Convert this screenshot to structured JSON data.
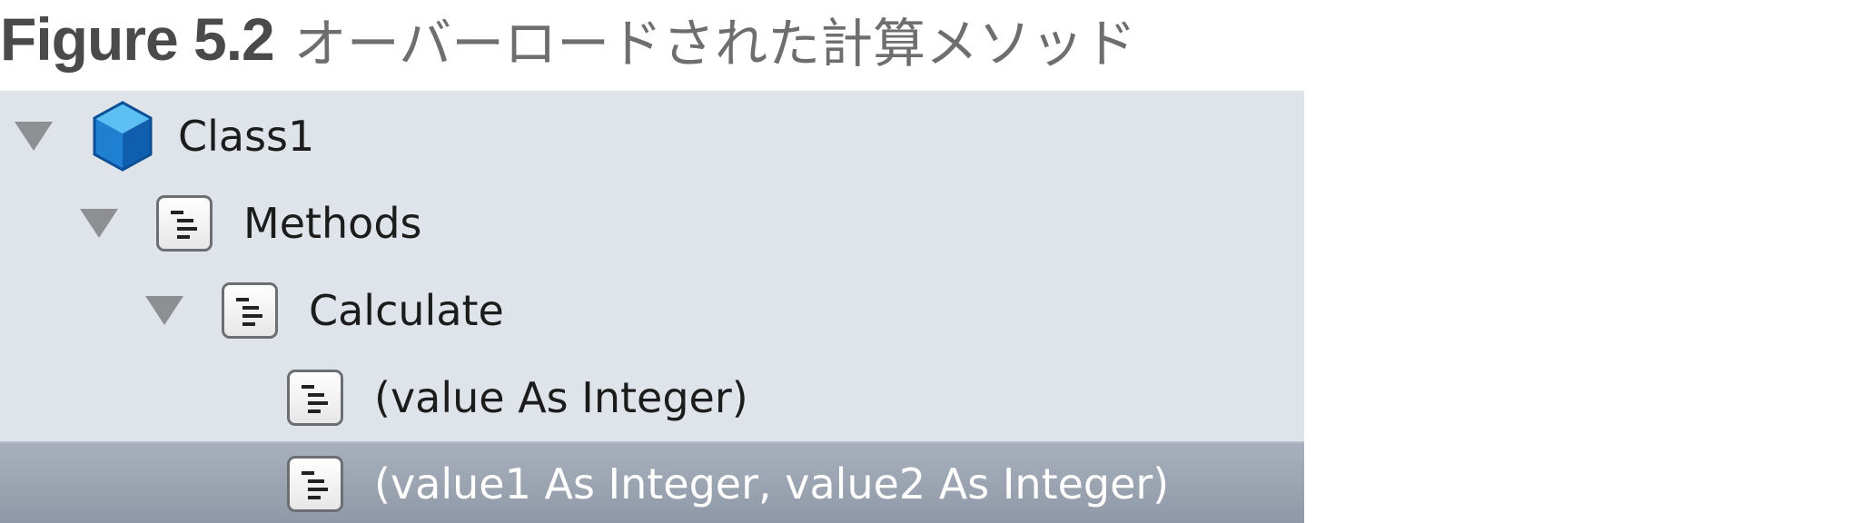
{
  "caption": {
    "label": "Figure 5.2",
    "text": "オーバーロードされた計算メソッド"
  },
  "tree": {
    "selected_color": "#9aa2af",
    "items": [
      {
        "label": "Class1",
        "icon": "cube-icon",
        "expanded": true,
        "level": 0
      },
      {
        "label": "Methods",
        "icon": "document-icon",
        "expanded": true,
        "level": 1
      },
      {
        "label": "Calculate",
        "icon": "document-icon",
        "expanded": true,
        "level": 2
      },
      {
        "label": "(value As Integer)",
        "icon": "document-icon",
        "level": 3
      },
      {
        "label": "(value1 As Integer, value2 As Integer)",
        "icon": "document-icon",
        "level": 3,
        "selected": true
      }
    ]
  }
}
